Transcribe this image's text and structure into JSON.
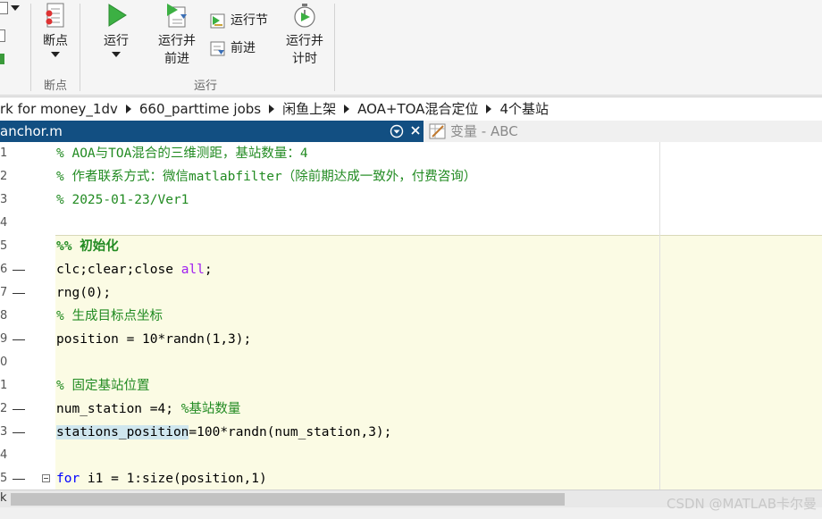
{
  "toolstrip": {
    "breakpoints_group": {
      "button_label": "断点",
      "group_label": "断点"
    },
    "run_group": {
      "group_label": "运行",
      "run_label": "运行",
      "run_advance_label_1": "运行并",
      "run_advance_label_2": "前进",
      "run_section_label": "运行节",
      "advance_label": "前进",
      "run_time_label_1": "运行并",
      "run_time_label_2": "计时"
    }
  },
  "address_bar": {
    "crumbs": [
      "rk for money_1dv",
      "660_parttime jobs",
      "闲鱼上架",
      "AOA+TOA混合定位",
      "4个基站"
    ]
  },
  "tabs": {
    "active_label": "anchor.m",
    "inactive_label": "变量 - ABC"
  },
  "editor": {
    "line_numbers": [
      "1",
      "2",
      "3",
      "4",
      "5",
      "6",
      "7",
      "8",
      "9",
      "0",
      "1",
      "2",
      "3",
      "4",
      "5"
    ],
    "lines": {
      "l1": "% AOA与TOA混合的三维测距，基站数量：4",
      "l2": "% 作者联系方式：微信matlabfilter（除前期达成一致外，付费咨询）",
      "l3": "% 2025-01-23/Ver1",
      "l5": "%% 初始化",
      "l6_a": "clc;clear;close ",
      "l6_b": "all",
      "l6_c": ";",
      "l7": "rng(0);",
      "l8": "% 生成目标点坐标",
      "l9": "position = 10*randn(1,3);",
      "l11": "% 固定基站位置",
      "l12_a": "num_station =4; ",
      "l12_b": "%基站数量",
      "l13_a": "stations_position",
      "l13_b": "=100*randn(num_station,3);",
      "l15_a": "for",
      "l15_b": " i1 = 1:size(position,1)"
    }
  },
  "scrollbar": {
    "label": "k"
  },
  "watermark": "CSDN @MATLAB卡尔曼",
  "colors": {
    "tab_active_bg": "#124f82",
    "comment": "#228b22",
    "keyword": "#0000ff",
    "string": "#a020f0",
    "cell_bg": "#fbfbe4",
    "highlight": "#cfe6ee"
  }
}
